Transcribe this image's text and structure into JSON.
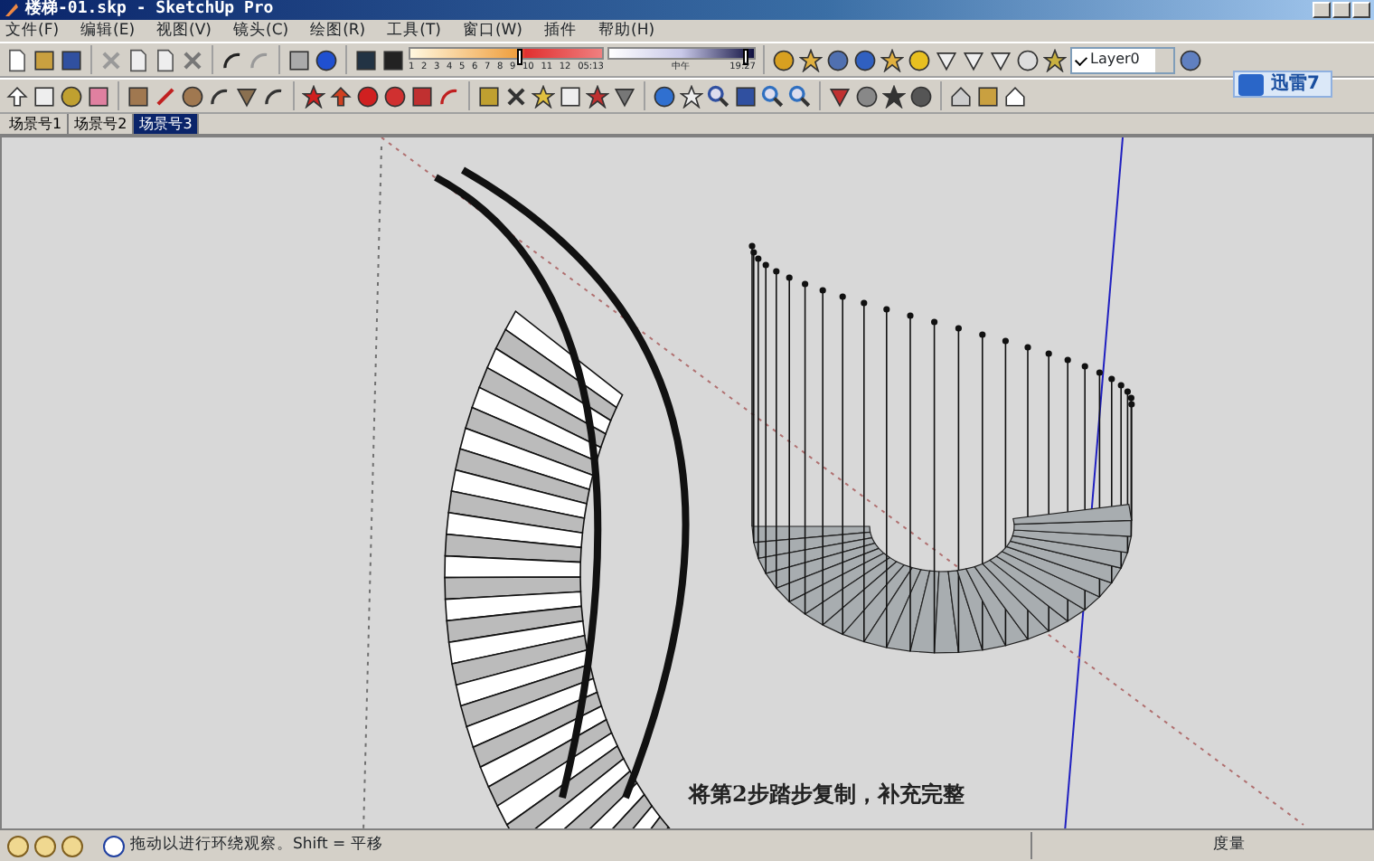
{
  "window": {
    "title": "楼梯-01.skp - SketchUp Pro"
  },
  "menu": [
    "文件(F)",
    "编辑(E)",
    "视图(V)",
    "镜头(C)",
    "绘图(R)",
    "工具(T)",
    "窗口(W)",
    "插件",
    "帮助(H)"
  ],
  "shadow_settings": {
    "months": [
      "1",
      "2",
      "3",
      "4",
      "5",
      "6",
      "7",
      "8",
      "9",
      "10",
      "11",
      "12"
    ],
    "date_slider": {
      "level": 0.56
    },
    "time_start": "05:13",
    "time_mid": "中午",
    "time_end": "19:27",
    "time_slider": {
      "level": 0.92
    }
  },
  "layer_dropdown": {
    "value": "Layer0",
    "checked": true
  },
  "popup_badge": {
    "label": "迅雷7"
  },
  "scene_tabs": [
    {
      "label": "场景号1",
      "selected": false
    },
    {
      "label": "场景号2",
      "selected": false
    },
    {
      "label": "场景号3",
      "selected": true
    }
  ],
  "viewport": {
    "caption": "将第2步踏步复制，补充完整"
  },
  "status_bar": {
    "hint": "拖动以进行环绕观察。Shift = 平移",
    "measure_label": "度量"
  }
}
